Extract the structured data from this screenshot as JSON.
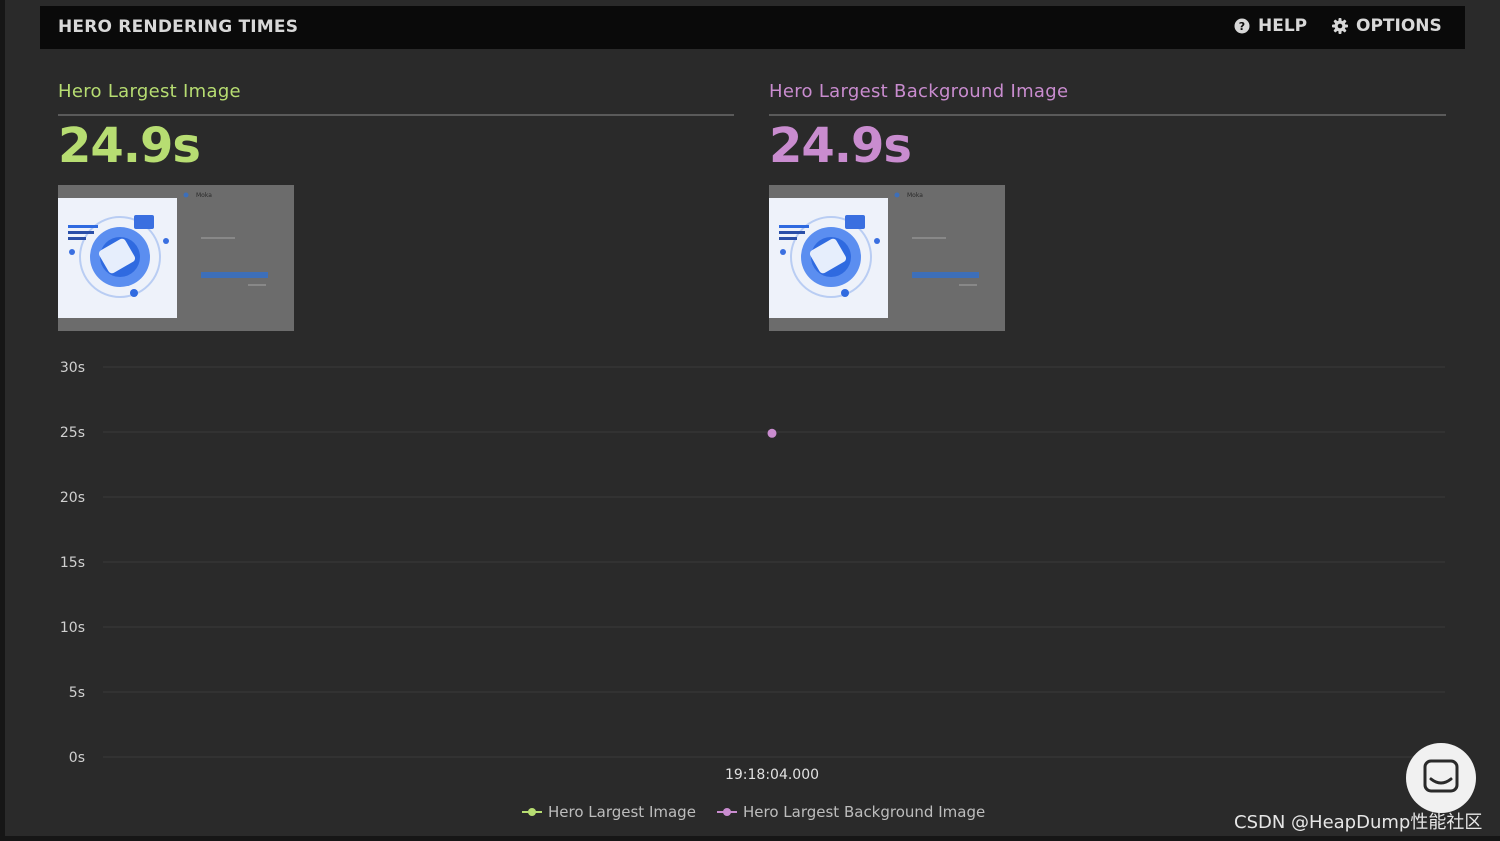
{
  "header": {
    "title": "HERO RENDERING TIMES",
    "help_label": "HELP",
    "options_label": "OPTIONS"
  },
  "metrics": [
    {
      "label": "Hero Largest Image",
      "value": "24.9s",
      "color": "#b7dd72"
    },
    {
      "label": "Hero Largest Background Image",
      "value": "24.9s",
      "color": "#c98ccf"
    }
  ],
  "thumbnails": {
    "brand": "Moka",
    "card_text": "Moka People",
    "card_text_cn": "正式上线"
  },
  "chart_data": {
    "type": "scatter",
    "x": [
      "19:18:04.000"
    ],
    "series": [
      {
        "name": "Hero Largest Image",
        "color": "#b7dd72",
        "values": []
      },
      {
        "name": "Hero Largest Background Image",
        "color": "#c98ccf",
        "values": [
          24.9
        ]
      }
    ],
    "ylim": [
      0,
      30
    ],
    "yticks": [
      0,
      5,
      10,
      15,
      20,
      25,
      30
    ],
    "ytick_labels": [
      "0s",
      "5s",
      "10s",
      "15s",
      "20s",
      "25s",
      "30s"
    ],
    "grid": true,
    "legend_position": "bottom-center"
  },
  "legend": {
    "items": [
      {
        "label": "Hero Largest Image",
        "color": "#b7dd72"
      },
      {
        "label": "Hero Largest Background Image",
        "color": "#c98ccf"
      }
    ]
  },
  "icons": {
    "help": "help-circle-icon",
    "options": "gear-icon",
    "chat": "chat-icon"
  },
  "watermark": "CSDN @HeapDump性能社区"
}
